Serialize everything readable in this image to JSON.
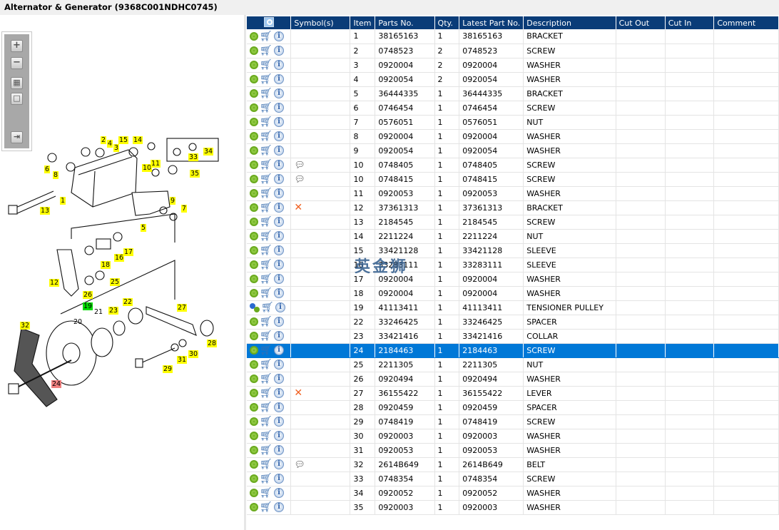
{
  "window": {
    "title": "Alternator & Generator (9368C001NDHC0745)"
  },
  "toolbar": {
    "zoom_in": "+",
    "zoom_out": "−",
    "fit": "▦",
    "actual": "□",
    "export": "⇥"
  },
  "diagram": {
    "callouts": [
      "2",
      "4",
      "3",
      "15",
      "14",
      "6",
      "8",
      "10",
      "11",
      "33",
      "34",
      "35",
      "1",
      "13",
      "9",
      "7",
      "5",
      "17",
      "16",
      "18",
      "12",
      "26",
      "25",
      "19",
      "21",
      "20",
      "22",
      "23",
      "27",
      "32",
      "28",
      "30",
      "31",
      "29",
      "24"
    ],
    "highlighted_callout": "24",
    "selected_group": "19"
  },
  "watermark": "英金狮",
  "table": {
    "columns": [
      "",
      "Symbol(s)",
      "Item",
      "Parts No.",
      "Qty.",
      "Latest Part No.",
      "Description",
      "Cut Out",
      "Cut In",
      "Comment"
    ],
    "header_icon": "search-preview-icon",
    "selected_item": "24",
    "rows": [
      [
        "",
        "1",
        "38165163",
        "1",
        "38165163",
        "BRACKET"
      ],
      [
        "",
        "2",
        "0748523",
        "2",
        "0748523",
        "SCREW"
      ],
      [
        "",
        "3",
        "0920004",
        "2",
        "0920004",
        "WASHER"
      ],
      [
        "",
        "4",
        "0920054",
        "2",
        "0920054",
        "WASHER"
      ],
      [
        "",
        "5",
        "36444335",
        "1",
        "36444335",
        "BRACKET"
      ],
      [
        "",
        "6",
        "0746454",
        "1",
        "0746454",
        "SCREW"
      ],
      [
        "",
        "7",
        "0576051",
        "1",
        "0576051",
        "NUT"
      ],
      [
        "",
        "8",
        "0920004",
        "1",
        "0920004",
        "WASHER"
      ],
      [
        "",
        "9",
        "0920054",
        "1",
        "0920054",
        "WASHER"
      ],
      [
        "comment",
        "10",
        "0748405",
        "1",
        "0748405",
        "SCREW"
      ],
      [
        "comment",
        "10",
        "0748415",
        "1",
        "0748415",
        "SCREW"
      ],
      [
        "",
        "11",
        "0920053",
        "1",
        "0920053",
        "WASHER"
      ],
      [
        "x",
        "12",
        "37361313",
        "1",
        "37361313",
        "BRACKET"
      ],
      [
        "",
        "13",
        "2184545",
        "1",
        "2184545",
        "SCREW"
      ],
      [
        "",
        "14",
        "2211224",
        "1",
        "2211224",
        "NUT"
      ],
      [
        "",
        "15",
        "33421128",
        "1",
        "33421128",
        "SLEEVE"
      ],
      [
        "",
        "16",
        "33283111",
        "1",
        "33283111",
        "SLEEVE"
      ],
      [
        "",
        "17",
        "0920004",
        "1",
        "0920004",
        "WASHER"
      ],
      [
        "",
        "18",
        "0920004",
        "1",
        "0920004",
        "WASHER"
      ],
      [
        "",
        "19",
        "41113411",
        "1",
        "41113411",
        "TENSIONER PULLEY"
      ],
      [
        "",
        "22",
        "33246425",
        "1",
        "33246425",
        "SPACER"
      ],
      [
        "",
        "23",
        "33421416",
        "1",
        "33421416",
        "COLLAR"
      ],
      [
        "",
        "24",
        "2184463",
        "1",
        "2184463",
        "SCREW"
      ],
      [
        "",
        "25",
        "2211305",
        "1",
        "2211305",
        "NUT"
      ],
      [
        "",
        "26",
        "0920494",
        "1",
        "0920494",
        "WASHER"
      ],
      [
        "x",
        "27",
        "36155422",
        "1",
        "36155422",
        "LEVER"
      ],
      [
        "",
        "28",
        "0920459",
        "1",
        "0920459",
        "SPACER"
      ],
      [
        "",
        "29",
        "0748419",
        "1",
        "0748419",
        "SCREW"
      ],
      [
        "",
        "30",
        "0920003",
        "1",
        "0920003",
        "WASHER"
      ],
      [
        "",
        "31",
        "0920053",
        "1",
        "0920053",
        "WASHER"
      ],
      [
        "comment",
        "32",
        "2614B649",
        "1",
        "2614B649",
        "BELT"
      ],
      [
        "",
        "33",
        "0748354",
        "1",
        "0748354",
        "SCREW"
      ],
      [
        "",
        "34",
        "0920052",
        "1",
        "0920052",
        "WASHER"
      ],
      [
        "",
        "35",
        "0920003",
        "1",
        "0920003",
        "WASHER"
      ]
    ]
  },
  "colors": {
    "header_bg": "#0a3c78",
    "selected_row": "#0078d7",
    "callout": "#ffff00",
    "callout_group": "#00dd00",
    "callout_selected": "#f08080"
  }
}
